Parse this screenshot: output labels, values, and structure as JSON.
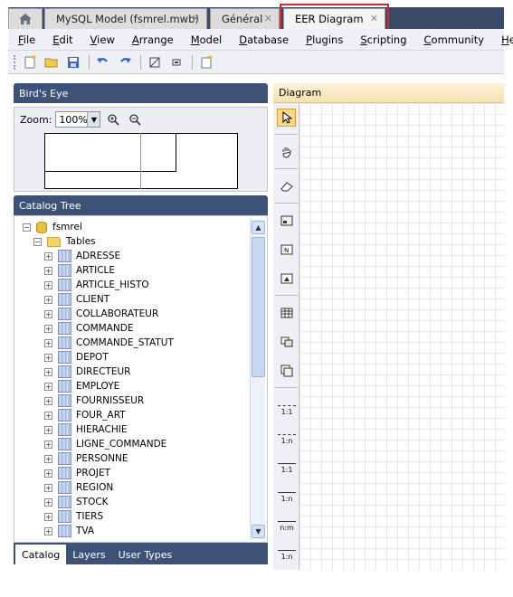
{
  "tabs": [
    {
      "label": "MySQL Model (fsmrel.mwb)",
      "active": false
    },
    {
      "label": "Général",
      "active": false
    },
    {
      "label": "EER Diagram",
      "active": true
    }
  ],
  "tab_close_glyph": "✕",
  "menu": [
    {
      "accel": "F",
      "rest": "ile"
    },
    {
      "accel": "E",
      "rest": "dit"
    },
    {
      "accel": "V",
      "rest": "iew"
    },
    {
      "accel": "A",
      "rest": "rrange"
    },
    {
      "accel": "M",
      "rest": "odel"
    },
    {
      "accel": "D",
      "rest": "atabase"
    },
    {
      "accel": "P",
      "rest": "lugins"
    },
    {
      "accel": "S",
      "rest": "cripting"
    },
    {
      "accel": "C",
      "rest": "ommunity"
    },
    {
      "accel": "H",
      "rest": "elp"
    }
  ],
  "toolbar_icons": [
    "new-document-icon",
    "open-folder-icon",
    "save-icon",
    "undo-icon",
    "redo-icon",
    "toggle-grid-icon",
    "align-objects-icon",
    "new-diagram-icon"
  ],
  "birds_eye": {
    "title": "Bird's Eye",
    "zoom_label": "Zoom:",
    "zoom_value": "100%"
  },
  "catalog": {
    "title": "Catalog Tree",
    "schema": "fsmrel",
    "folder": "Tables",
    "tables": [
      "ADRESSE",
      "ARTICLE",
      "ARTICLE_HISTO",
      "CLIENT",
      "COLLABORATEUR",
      "COMMANDE",
      "COMMANDE_STATUT",
      "DEPOT",
      "DIRECTEUR",
      "EMPLOYE",
      "FOURNISSEUR",
      "FOUR_ART",
      "HIERACHIE",
      "LIGNE_COMMANDE",
      "PERSONNE",
      "PROJET",
      "REGION",
      "STOCK",
      "TIERS",
      "TVA"
    ]
  },
  "bottom_tabs": [
    "Catalog",
    "Layers",
    "User Types"
  ],
  "diagram": {
    "title": "Diagram",
    "relationship_labels": [
      "1:1",
      "1:n",
      "1:1",
      "1:n",
      "n:m",
      "1:n"
    ]
  },
  "colors": {
    "panel_header": "#3c5377",
    "highlight_box": "#e3242b",
    "diagram_header": "#f6e2b0"
  }
}
